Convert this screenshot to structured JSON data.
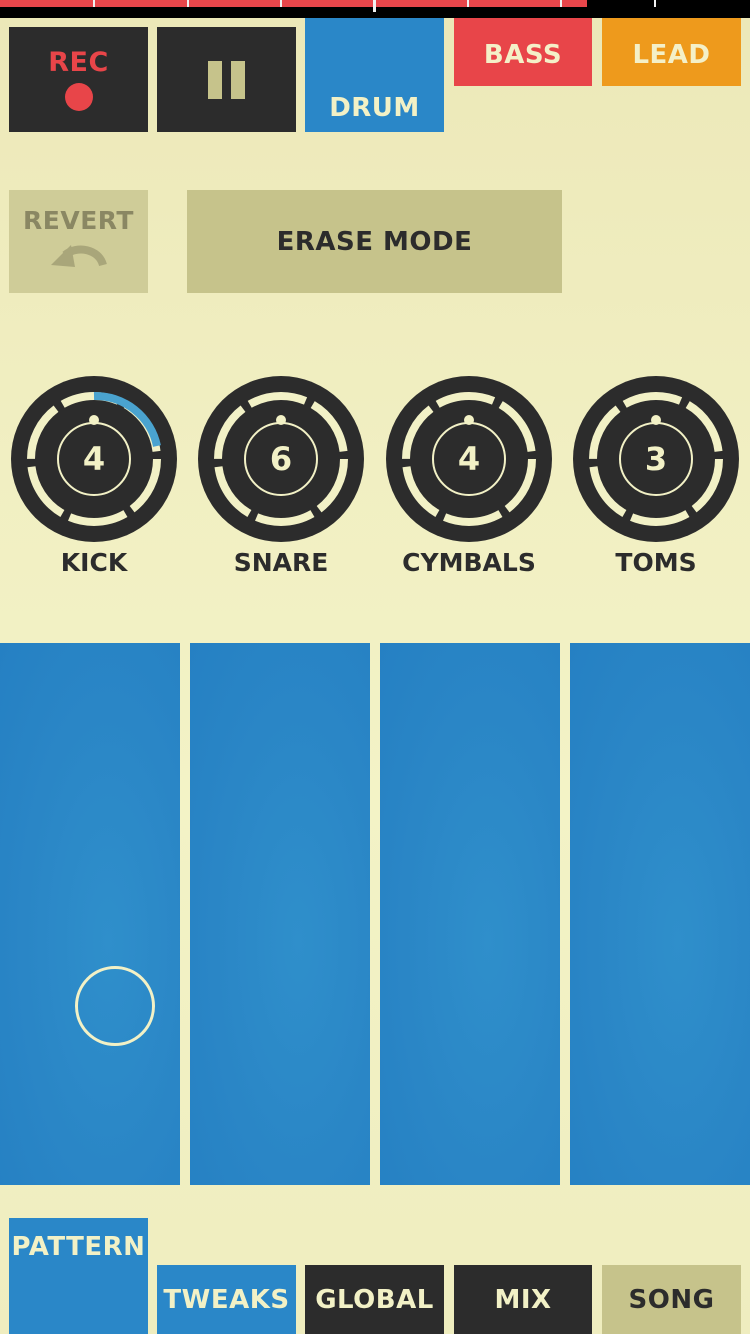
{
  "timeline": {
    "progress_fraction": 0.783
  },
  "top_buttons": {
    "rec_label": "REC",
    "drum_label": "DRUM",
    "bass_label": "BASS",
    "lead_label": "LEAD"
  },
  "actions": {
    "revert_label": "REVERT",
    "erase_mode_label": "ERASE MODE"
  },
  "knobs": [
    {
      "label": "KICK",
      "value": "4",
      "level": 0.15
    },
    {
      "label": "SNARE",
      "value": "6",
      "level": 0
    },
    {
      "label": "CYMBALS",
      "value": "4",
      "level": 0
    },
    {
      "label": "TOMS",
      "value": "3",
      "level": 0
    }
  ],
  "bottom_tabs": {
    "pattern": "PATTERN",
    "tweaks": "TWEAKS",
    "global": "GLOBAL",
    "mix": "MIX",
    "song": "SONG"
  },
  "colors": {
    "accent_blue": "#2a87c8",
    "red": "#e84549",
    "orange": "#ee9a1c",
    "dark": "#2c2c2c",
    "cream": "#f2f1c6",
    "khaki": "#c6c38b"
  }
}
